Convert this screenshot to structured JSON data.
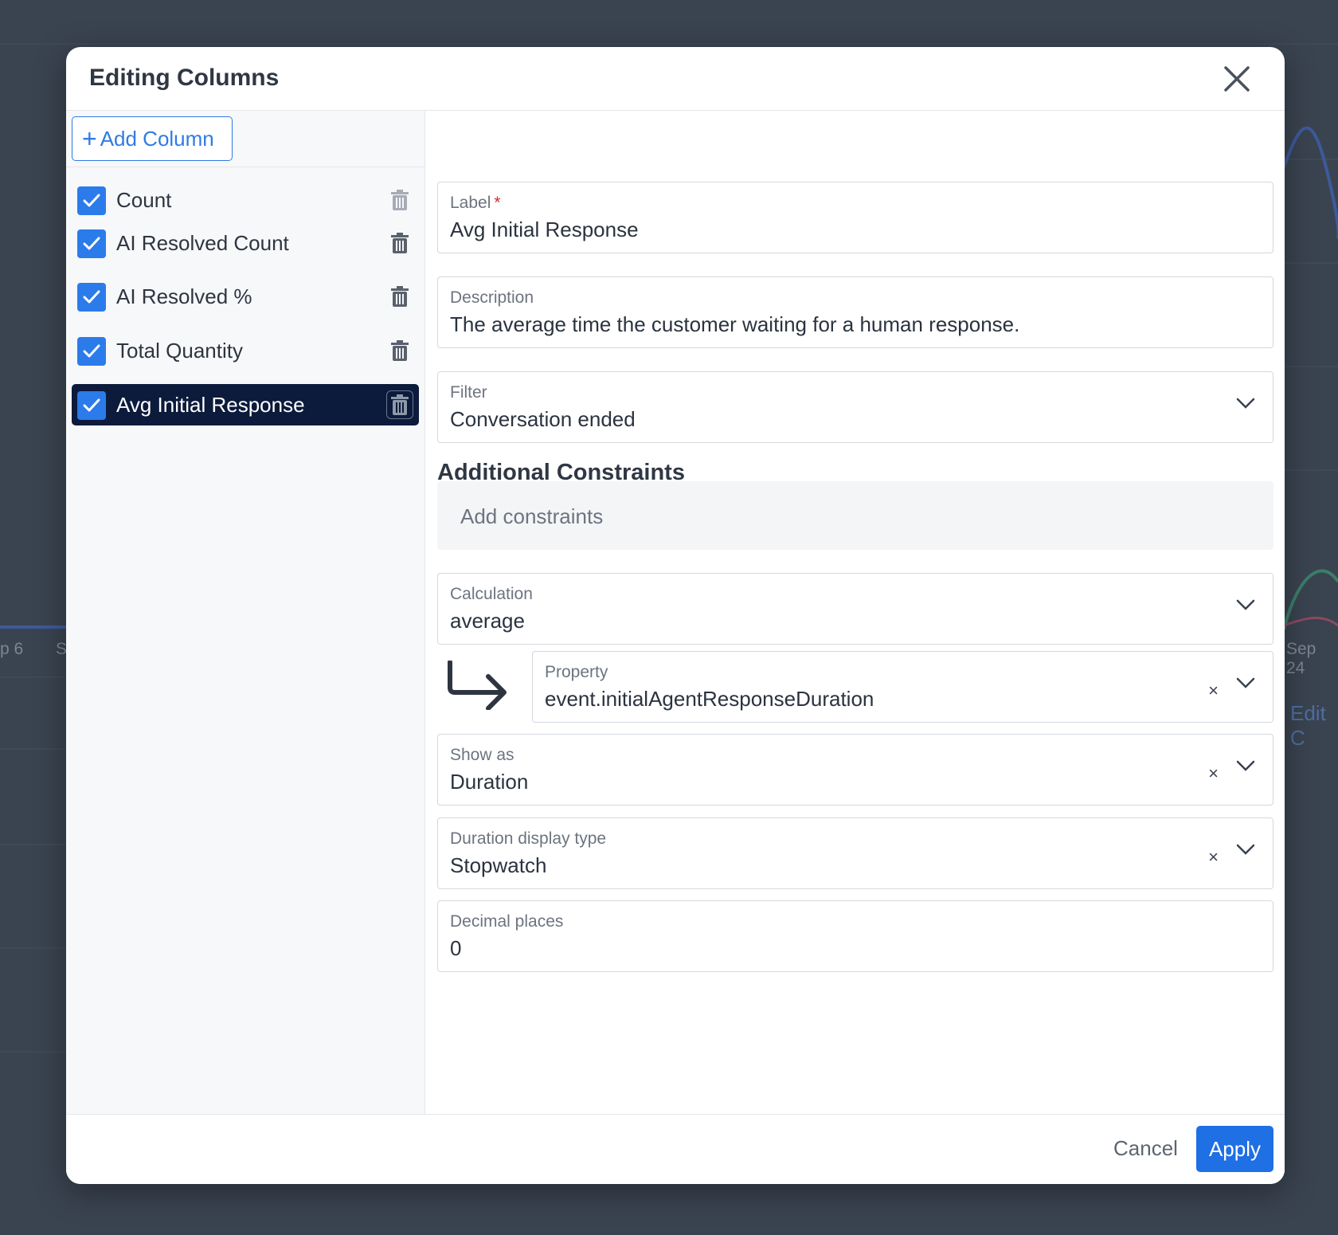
{
  "background": {
    "ticks": [
      "p 6",
      "S",
      "Sep 24"
    ],
    "edit_label": "Edit C"
  },
  "modal": {
    "title": "Editing Columns",
    "close_icon": "close-icon"
  },
  "columns_panel": {
    "add_button_label": "Add Column",
    "items": [
      {
        "label": "Count",
        "checked": true,
        "selected": false
      },
      {
        "label": "AI Resolved Count",
        "checked": true,
        "selected": false
      },
      {
        "label": "AI Resolved %",
        "checked": true,
        "selected": false
      },
      {
        "label": "Total Quantity",
        "checked": true,
        "selected": false
      },
      {
        "label": "Avg Initial Response",
        "checked": true,
        "selected": true
      }
    ]
  },
  "form": {
    "label": {
      "title": "Label",
      "required_mark": "*",
      "value": "Avg Initial Response"
    },
    "description": {
      "title": "Description",
      "value": "The average time the customer waiting for a human response."
    },
    "filter": {
      "title": "Filter",
      "value": "Conversation ended"
    },
    "additional_constraints": {
      "title": "Additional Constraints",
      "placeholder": "Add constraints"
    },
    "calculation": {
      "title": "Calculation",
      "value": "average"
    },
    "property": {
      "title": "Property",
      "value": "event.initialAgentResponseDuration",
      "clear": "×"
    },
    "show_as": {
      "title": "Show as",
      "value": "Duration",
      "clear": "×"
    },
    "duration_display_type": {
      "title": "Duration display type",
      "value": "Stopwatch",
      "clear": "×"
    },
    "decimal_places": {
      "title": "Decimal places",
      "value": "0"
    }
  },
  "footer": {
    "cancel_label": "Cancel",
    "apply_label": "Apply"
  },
  "colors": {
    "accent": "#1f6fe5",
    "selected_row": "#0c1a3c",
    "backdrop": "#3a4350"
  }
}
